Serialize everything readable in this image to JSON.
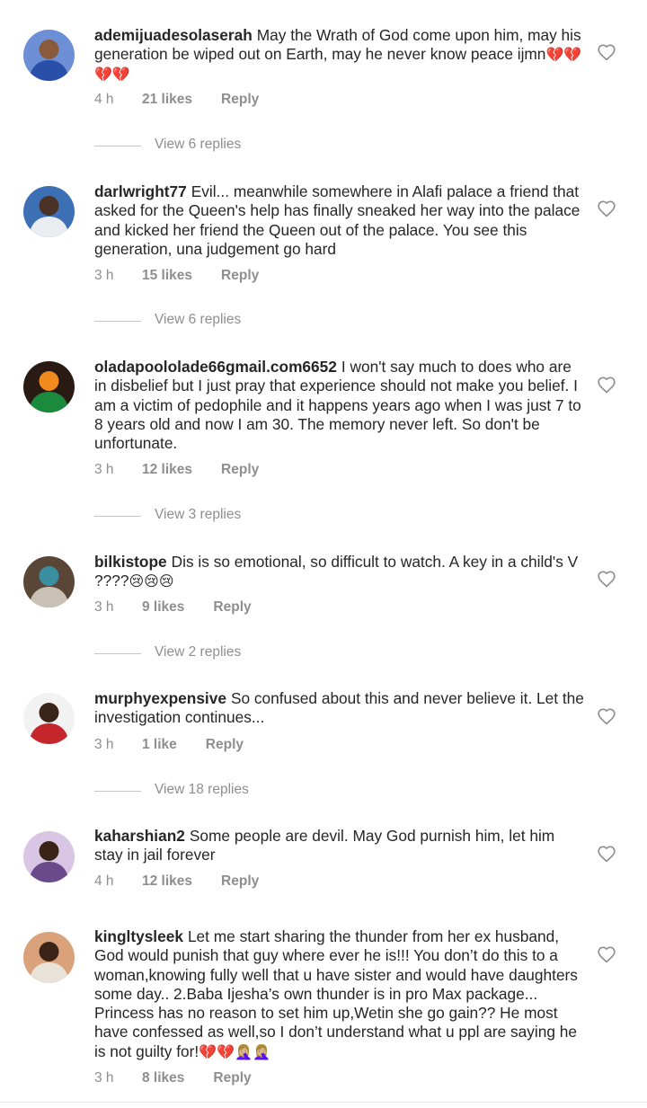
{
  "comments": [
    {
      "username": "ademijuadesolaserah",
      "text": "May the Wrath of God come upon him, may his generation be wiped out on Earth, may he never know peace ijmn",
      "emoji": "💔💔💔💔",
      "time": "4 h",
      "likes": "21 likes",
      "reply": "Reply",
      "view_replies": "View 6 replies",
      "avatar_colors": [
        "#2a4fa8",
        "#8a5a3c",
        "#6d8fd6"
      ]
    },
    {
      "username": "darlwright77",
      "text": "Evil... meanwhile somewhere in Alafi palace a friend that asked for the Queen's help has finally sneaked her way into the palace and kicked her friend the Queen out of the palace. You see this generation, una judgement go hard",
      "emoji": "",
      "time": "3 h",
      "likes": "15 likes",
      "reply": "Reply",
      "view_replies": "View 6 replies",
      "avatar_colors": [
        "#e9edf2",
        "#4a3326",
        "#3d6fb5"
      ]
    },
    {
      "username": "oladapoololade66gmail.com6652",
      "text": "I won't say much to does who are in disbelief but I just pray that experience should not make you belief. I am a victim of pedophile and it happens years ago when I was just 7 to 8 years old and now I am 30. The memory never left. So don't be unfortunate.",
      "emoji": "",
      "time": "3 h",
      "likes": "12 likes",
      "reply": "Reply",
      "view_replies": "View 3 replies",
      "avatar_colors": [
        "#1b8a3c",
        "#f08a1c",
        "#2a1a14"
      ]
    },
    {
      "username": "bilkistope",
      "text": "Dis is so emotional, so  difficult to watch. A key in a child's V ????",
      "emoji": "😢😢😢",
      "time": "3 h",
      "likes": "9 likes",
      "reply": "Reply",
      "view_replies": "View 2 replies",
      "avatar_colors": [
        "#c9c2b4",
        "#3a8fa0",
        "#5a4636"
      ]
    },
    {
      "username": "murphyexpensive",
      "text": "So confused about this and never believe it. Let the investigation continues...",
      "emoji": "",
      "time": "3 h",
      "likes": "1 like",
      "reply": "Reply",
      "view_replies": "View 18 replies",
      "avatar_colors": [
        "#c4262b",
        "#3b2418",
        "#f2f2f2"
      ]
    },
    {
      "username": "kaharshian2",
      "text": "Some people are devil. May God purnish him, let him stay in jail forever",
      "emoji": "",
      "time": "4 h",
      "likes": "12 likes",
      "reply": "Reply",
      "view_replies": "",
      "avatar_colors": [
        "#6b4a8c",
        "#3a2418",
        "#d8c6e4"
      ]
    },
    {
      "username": "kingltysleek",
      "text": "Let me start sharing the thunder from her ex husband, God would punish that guy where ever he is!!! You don’t do this to a woman,knowing fully well that u have sister and would have daughters some day.. 2.Baba Ijesha’s own thunder is in pro Max package... Princess has no reason to set him up,Wetin  she go gain?? He most have confessed as well,so I don’t understand what u ppl are saying he is not guilty for!",
      "emoji": "💔💔🤦🏼‍♀️🤦🏼‍♀️",
      "time": "3 h",
      "likes": "8 likes",
      "reply": "Reply",
      "view_replies": "",
      "avatar_colors": [
        "#e8e2d8",
        "#3a2418",
        "#d9a27a"
      ]
    }
  ],
  "icons": {
    "like": "heart-outline-icon"
  },
  "colors": {
    "secondary_text": "#8e8e8e",
    "primary_text": "#262626",
    "divider": "#c7c7c7"
  }
}
